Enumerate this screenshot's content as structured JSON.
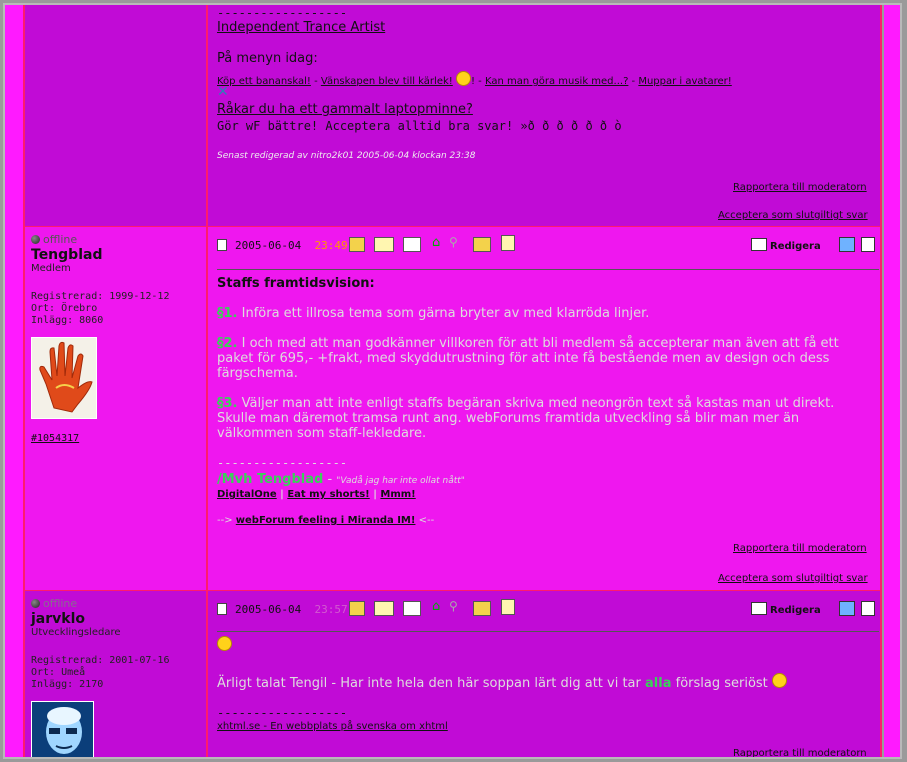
{
  "top_post": {
    "separator": "------------------",
    "sig_link": "Independent Trance Artist ",
    "menu_heading": "På menyn idag:",
    "menu_links": [
      "Köp ett bananskal!",
      "Vänskapen blev till kärlek!",
      "Kan man göra musik med...?",
      "Muppar i avatarer!"
    ],
    "laptop_link": "Råkar du ha ett gammalt laptopminne?",
    "better_text": "Gör wF bättre! Acceptera alltid bra svar! »ð ð ð ð ð ð ò",
    "edited_text": "Senast redigerad av nitro2k01 2005-06-04 klockan 23:38",
    "report_link": "Rapportera till moderatorn",
    "accept_link": "Acceptera som slutgiltigt svar"
  },
  "post_tengblad": {
    "status": "offline",
    "username": "Tengblad",
    "role": "Medlem",
    "registered": "Registrerad: 1999-12-12",
    "city": "Ort: Örebro",
    "posts": "Inlägg: 8060",
    "post_id": "#1054317",
    "date": "2005-06-04",
    "time": "23:49",
    "edit_label": "Redigera",
    "heading": "Staffs framtidsvision:",
    "p1_mark": "§1.",
    "p1": " Införa ett illrosa tema som gärna bryter av med klarröda linjer.",
    "p2_mark": "§2.",
    "p2": " I och med att man godkänner villkoren för att bli medlem så accepterar man även att få ett paket för 695,- +frakt, med skyddutrustning för att inte få bestående men av design och dess färgschema.",
    "p3_mark": "§3.",
    "p3": " Väljer man att inte enligt staffs begäran skriva med neongrön text så kastas man ut direkt. Skulle man däremot tramsa runt ang. webForums framtida utveckling så blir man mer än välkommen som staff-lekledare.",
    "separator": "------------------",
    "sig_name": "/Mvh Tengblad",
    "sig_dash": " - ",
    "sig_quote": "\"Vadå jag har inte ollat nått\"",
    "sig_links": [
      "DigitalOne",
      "Eat my shorts!",
      "Mmm!"
    ],
    "sig_arrow_pre": "--> ",
    "sig_miranda": "webForum feeling i Miranda IM!",
    "sig_arrow_post": " <--",
    "report_link": "Rapportera till moderatorn",
    "accept_link": "Acceptera som slutgiltigt svar"
  },
  "post_jarvklo": {
    "status": "offline",
    "username": "jarvklo",
    "role": "Utvecklingsledare",
    "registered": "Registrerad: 2001-07-16",
    "city": "Ort: Umeå",
    "posts": "Inlägg: 2170",
    "date": "2005-06-04",
    "time": "23:57",
    "edit_label": "Redigera",
    "text_pre": "Ärligt talat Tengil - Har inte hela den här soppan lärt dig att vi tar ",
    "text_bold": "alla",
    "text_post": " förslag seriöst ",
    "separator": "------------------",
    "sig_link": "xhtml.se - En webbplats på svenska om xhtml",
    "report_link": "Rapportera till moderatorn"
  },
  "colors": {
    "dark_row": "#c10bd6",
    "light_row": "#ef17ef",
    "stripe": "#ff1aff",
    "rule": "#ff1a6e",
    "neon_green": "#3bd05a",
    "time_orange": "#ff9900"
  }
}
